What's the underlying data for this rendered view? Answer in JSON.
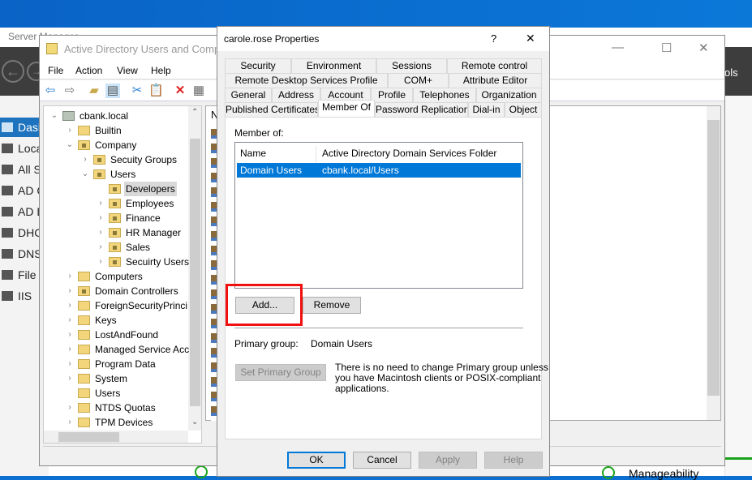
{
  "server_manager": {
    "title": "Server Manager",
    "tools_label": "ols",
    "nav": [
      "Dash",
      "Loca",
      "All S",
      "AD C",
      "AD D",
      "DHC",
      "DNS",
      "File a",
      "IIS"
    ],
    "selected_nav": 0,
    "tile_label": "Manageability"
  },
  "aduc": {
    "title": "Active Directory Users and Computers",
    "menu": [
      "File",
      "Action",
      "View",
      "Help"
    ],
    "toolbar_icons": [
      "back-icon",
      "forward-icon",
      "up-folder-icon",
      "show-tree-icon",
      "cut-icon",
      "paste-icon",
      "delete-icon",
      "properties-icon"
    ],
    "right_header": "N",
    "tree": [
      {
        "label": "cbank.local",
        "level": 0,
        "exp": "open",
        "icon": "domain"
      },
      {
        "label": "Builtin",
        "level": 1,
        "exp": "closed",
        "icon": "folder"
      },
      {
        "label": "Company",
        "level": 1,
        "exp": "open",
        "icon": "ou"
      },
      {
        "label": "Secuity Groups",
        "level": 2,
        "exp": "closed",
        "icon": "ou"
      },
      {
        "label": "Users",
        "level": 2,
        "exp": "open",
        "icon": "ou"
      },
      {
        "label": "Developers",
        "level": 3,
        "exp": "none",
        "icon": "ou",
        "selected": true
      },
      {
        "label": "Employees",
        "level": 3,
        "exp": "closed",
        "icon": "ou"
      },
      {
        "label": "Finance",
        "level": 3,
        "exp": "closed",
        "icon": "ou"
      },
      {
        "label": "HR Manager",
        "level": 3,
        "exp": "closed",
        "icon": "ou"
      },
      {
        "label": "Sales",
        "level": 3,
        "exp": "closed",
        "icon": "ou"
      },
      {
        "label": "Secuirty Users",
        "level": 3,
        "exp": "closed",
        "icon": "ou"
      },
      {
        "label": "Computers",
        "level": 1,
        "exp": "closed",
        "icon": "folder"
      },
      {
        "label": "Domain Controllers",
        "level": 1,
        "exp": "closed",
        "icon": "ou"
      },
      {
        "label": "ForeignSecurityPrinci",
        "level": 1,
        "exp": "closed",
        "icon": "folder"
      },
      {
        "label": "Keys",
        "level": 1,
        "exp": "closed",
        "icon": "folder"
      },
      {
        "label": "LostAndFound",
        "level": 1,
        "exp": "closed",
        "icon": "folder"
      },
      {
        "label": "Managed Service Acc",
        "level": 1,
        "exp": "closed",
        "icon": "folder"
      },
      {
        "label": "Program Data",
        "level": 1,
        "exp": "closed",
        "icon": "folder"
      },
      {
        "label": "System",
        "level": 1,
        "exp": "closed",
        "icon": "folder"
      },
      {
        "label": "Users",
        "level": 1,
        "exp": "none",
        "icon": "folder"
      },
      {
        "label": "NTDS Quotas",
        "level": 1,
        "exp": "closed",
        "icon": "folder"
      },
      {
        "label": "TPM Devices",
        "level": 1,
        "exp": "closed",
        "icon": "folder"
      }
    ]
  },
  "dialog": {
    "title": "carole.rose Properties",
    "help_glyph": "?",
    "close_glyph": "✕",
    "tab_rows": [
      [
        "Security",
        "Environment",
        "Sessions",
        "Remote control"
      ],
      [
        "Remote Desktop Services Profile",
        "COM+",
        "Attribute Editor"
      ],
      [
        "General",
        "Address",
        "Account",
        "Profile",
        "Telephones",
        "Organization"
      ],
      [
        "Published Certificates",
        "Member Of",
        "Password Replication",
        "Dial-in",
        "Object"
      ]
    ],
    "active_tab": "Member Of",
    "member_of_label": "Member of:",
    "columns": [
      "Name",
      "Active Directory Domain Services Folder"
    ],
    "rows": [
      {
        "name": "Domain Users",
        "folder": "cbank.local/Users",
        "selected": true
      }
    ],
    "add_label": "Add...",
    "remove_label": "Remove",
    "primary_group_label": "Primary group:",
    "primary_group_value": "Domain Users",
    "set_primary_label": "Set Primary Group",
    "note_lines": [
      "There is no need to change Primary group unless",
      "you have Macintosh clients or POSIX-compliant",
      "applications."
    ],
    "ok_label": "OK",
    "cancel_label": "Cancel",
    "apply_label": "Apply",
    "help_label": "Help",
    "highlight_color": "#f01010",
    "accent_color": "#0078d7"
  }
}
